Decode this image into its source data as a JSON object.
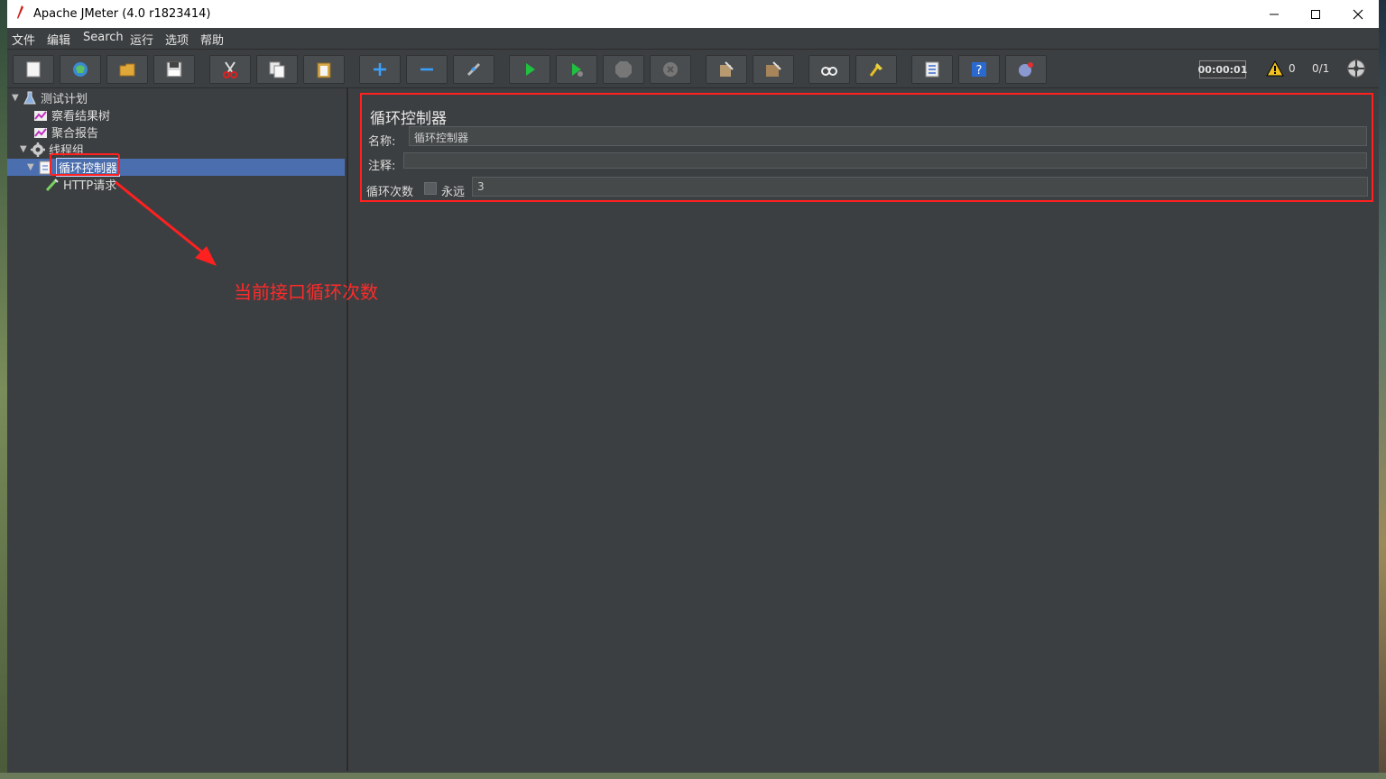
{
  "window": {
    "title": "Apache JMeter (4.0 r1823414)",
    "minimize": "—",
    "maximize": "☐",
    "close": "✕"
  },
  "menu": [
    "文件",
    "编辑",
    "Search",
    "运行",
    "选项",
    "帮助"
  ],
  "toolbar": {
    "buttons": [
      "new-icon",
      "templates-icon",
      "open-icon",
      "save-icon",
      "cut-icon",
      "copy-icon",
      "paste-icon",
      "expand-icon",
      "collapse-icon",
      "toggle-icon",
      "start-icon",
      "start-no-pause-icon",
      "stop-icon",
      "shutdown-icon",
      "clear-icon",
      "clear-all-icon",
      "search-icon",
      "reset-search-icon",
      "function-helper-icon",
      "help-icon",
      "remote-icon"
    ],
    "timer": "00:00:01",
    "warnings": "0",
    "threads": "0/1"
  },
  "tree": {
    "items": [
      {
        "label": "测试计划"
      },
      {
        "label": "察看结果树"
      },
      {
        "label": "聚合报告"
      },
      {
        "label": "线程组"
      },
      {
        "label": "循环控制器"
      },
      {
        "label": "HTTP请求"
      }
    ]
  },
  "panel": {
    "title": "循环控制器",
    "name_label": "名称:",
    "name_value": "循环控制器",
    "comment_label": "注释:",
    "comment_value": "",
    "loop_label": "循环次数",
    "forever_label": "永远",
    "forever_checked": false,
    "loop_value": "3"
  },
  "annotation": {
    "text": "当前接口循环次数",
    "color": "#ff2a2a"
  }
}
